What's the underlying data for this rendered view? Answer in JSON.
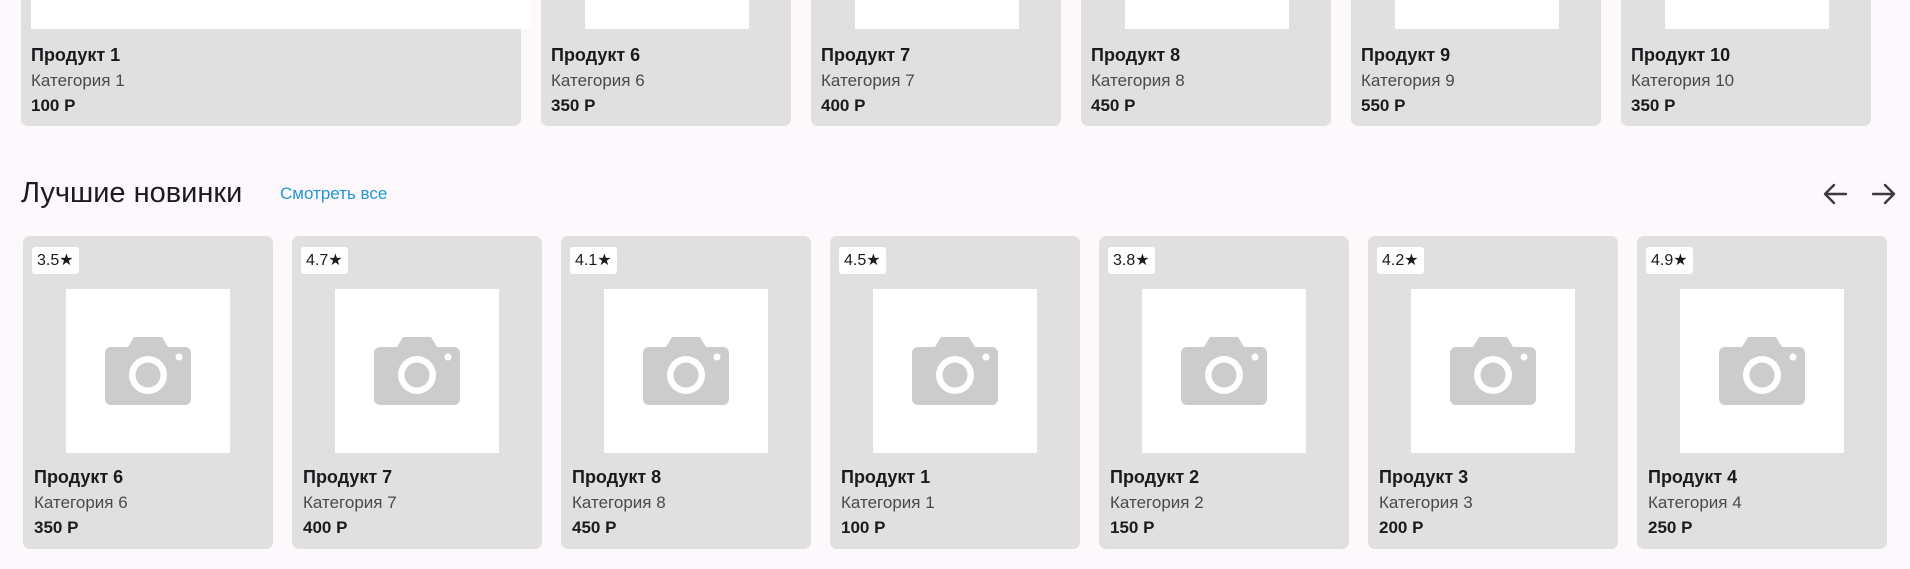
{
  "top_row": {
    "items": [
      {
        "name": "Продукт 1",
        "category": "Категория 1",
        "price": "100 Р"
      },
      {
        "name": "Продукт 6",
        "category": "Категория 6",
        "price": "350 Р"
      },
      {
        "name": "Продукт 7",
        "category": "Категория 7",
        "price": "400 Р"
      },
      {
        "name": "Продукт 8",
        "category": "Категория 8",
        "price": "450 Р"
      },
      {
        "name": "Продукт 9",
        "category": "Категория 9",
        "price": "550 Р"
      },
      {
        "name": "Продукт 10",
        "category": "Категория 10",
        "price": "350 Р"
      }
    ]
  },
  "new_arrivals": {
    "title": "Лучшие новинки",
    "see_all": "Смотреть все",
    "prev_icon": "arrow-left-icon",
    "next_icon": "arrow-right-icon",
    "placeholder_icon": "camera-icon",
    "colors": {
      "card": "#e0e0e0",
      "link": "#2196d6",
      "placeholder": "#cccccc"
    },
    "items": [
      {
        "rating": "3.5★",
        "name": "Продукт 6",
        "category": "Категория 6",
        "price": "350 Р"
      },
      {
        "rating": "4.7★",
        "name": "Продукт 7",
        "category": "Категория 7",
        "price": "400 Р"
      },
      {
        "rating": "4.1★",
        "name": "Продукт 8",
        "category": "Категория 8",
        "price": "450 Р"
      },
      {
        "rating": "4.5★",
        "name": "Продукт 1",
        "category": "Категория 1",
        "price": "100 Р"
      },
      {
        "rating": "3.8★",
        "name": "Продукт 2",
        "category": "Категория 2",
        "price": "150 Р"
      },
      {
        "rating": "4.2★",
        "name": "Продукт 3",
        "category": "Категория 3",
        "price": "200 Р"
      },
      {
        "rating": "4.9★",
        "name": "Продукт 4",
        "category": "Категория 4",
        "price": "250 Р"
      }
    ]
  }
}
